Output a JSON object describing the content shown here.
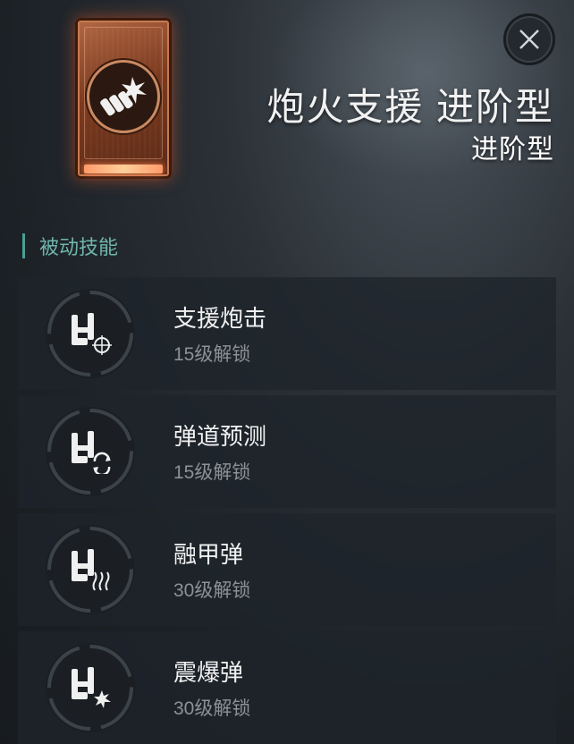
{
  "header": {
    "title": "炮火支援 进阶型",
    "subtitle": "进阶型",
    "close_icon": "close-icon"
  },
  "card": {
    "icon": "artillery-support-icon",
    "accent": "#b35a30"
  },
  "section": {
    "label": "被动技能",
    "accent": "#4a9e96"
  },
  "skills": [
    {
      "name": "支援炮击",
      "unlock": "15级解锁",
      "icon": "support-strike-icon"
    },
    {
      "name": "弹道预测",
      "unlock": "15级解锁",
      "icon": "trajectory-predict-icon"
    },
    {
      "name": "融甲弹",
      "unlock": "30级解锁",
      "icon": "armor-melt-shell-icon"
    },
    {
      "name": "震爆弹",
      "unlock": "30级解锁",
      "icon": "concussion-shell-icon"
    }
  ]
}
